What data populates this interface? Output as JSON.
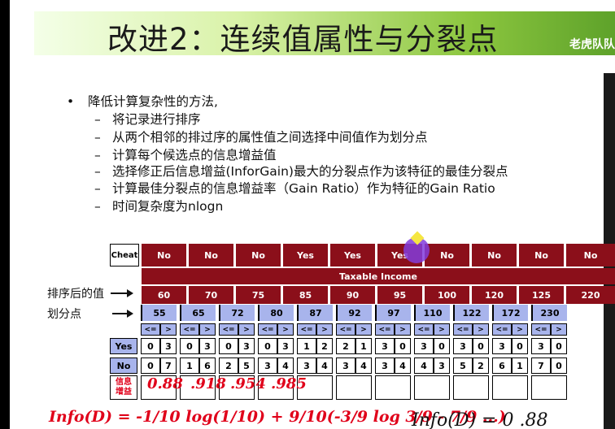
{
  "title": {
    "main": "改进2：连续值属性与分裂点",
    "tag": "老虎队队"
  },
  "bullets": {
    "main": "降低计算复杂性的方法,",
    "sub": [
      "将记录进行排序",
      "从两个相邻的排过序的属性值之间选择中间值作为划分点",
      "计算每个候选点的信息增益值",
      "选择修正后信息增益(InforGain)最大的分裂点作为该特征的最佳分裂点",
      "计算最佳分裂点的信息增益率（Gain Ratio）作为特征的Gain Ratio",
      "时间复杂度为nlogn"
    ],
    "dash": "–"
  },
  "side_labels": {
    "sorted": "排序后的值",
    "split": "划分点"
  },
  "table": {
    "cheat_label": "Cheat",
    "cheat_values": [
      "No",
      "No",
      "No",
      "Yes",
      "Yes",
      "Yes",
      "No",
      "No",
      "No",
      "No"
    ],
    "header": "Taxable Income",
    "sorted_values": [
      "60",
      "70",
      "75",
      "85",
      "90",
      "95",
      "100",
      "120",
      "125",
      "220"
    ],
    "split_points": [
      "55",
      "65",
      "72",
      "80",
      "87",
      "92",
      "97",
      "110",
      "122",
      "172",
      "230"
    ],
    "le": "<=",
    "gt": ">",
    "yes_label": "Yes",
    "no_label": "No",
    "yes_counts": [
      [
        "0",
        "3"
      ],
      [
        "0",
        "3"
      ],
      [
        "0",
        "3"
      ],
      [
        "0",
        "3"
      ],
      [
        "1",
        "2"
      ],
      [
        "2",
        "1"
      ],
      [
        "3",
        "0"
      ],
      [
        "3",
        "0"
      ],
      [
        "3",
        "0"
      ],
      [
        "3",
        "0"
      ],
      [
        "3",
        "0"
      ]
    ],
    "no_counts": [
      [
        "0",
        "7"
      ],
      [
        "1",
        "6"
      ],
      [
        "2",
        "5"
      ],
      [
        "3",
        "4"
      ],
      [
        "3",
        "4"
      ],
      [
        "3",
        "4"
      ],
      [
        "3",
        "4"
      ],
      [
        "4",
        "3"
      ],
      [
        "5",
        "2"
      ],
      [
        "6",
        "1"
      ],
      [
        "7",
        "0"
      ]
    ],
    "gain_label": "信息增益"
  },
  "handwriting": {
    "gains": [
      "0.88",
      ".918",
      ".954",
      ".985"
    ],
    "formula": "Info(D) = -1/10 log(1/10) + 9/10(-3/9 log 3/9 - 7/9 ...)"
  },
  "formula": {
    "text": "Info(D)  =  0 .88"
  }
}
